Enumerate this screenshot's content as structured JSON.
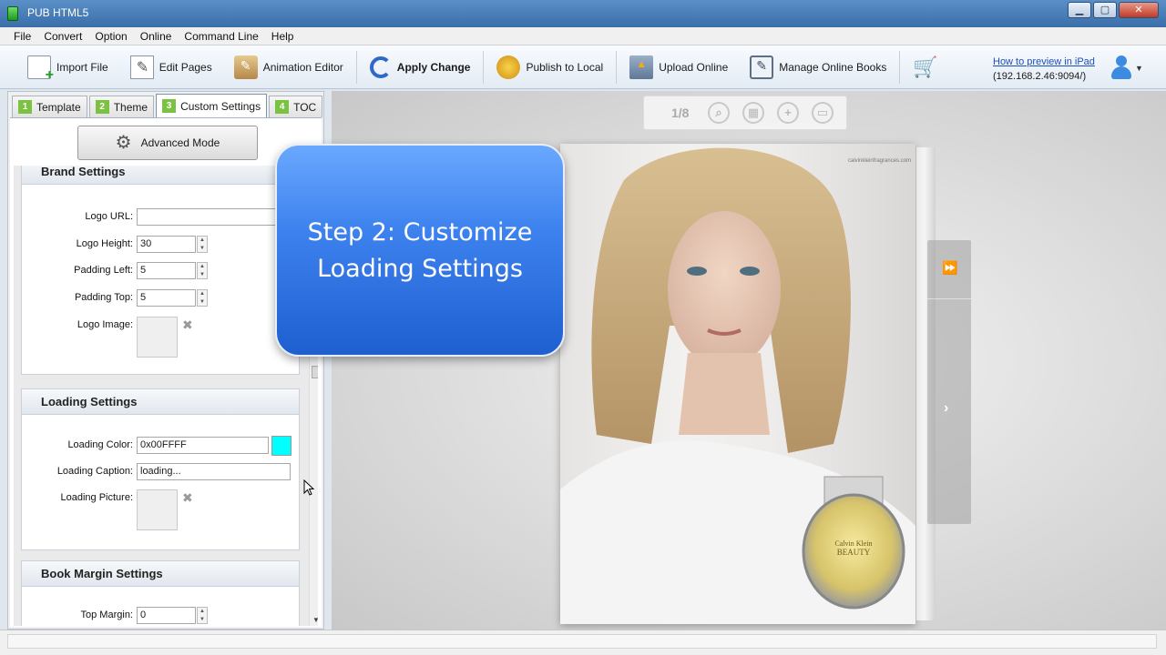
{
  "window": {
    "title": "PUB HTML5",
    "min": "▁",
    "max": "▢",
    "close": "✕"
  },
  "menu": [
    "File",
    "Convert",
    "Option",
    "Online",
    "Command Line",
    "Help"
  ],
  "toolbar": {
    "import": "Import File",
    "edit": "Edit Pages",
    "animation": "Animation Editor",
    "apply": "Apply Change",
    "publish": "Publish to Local",
    "upload": "Upload Online",
    "manage": "Manage Online Books",
    "preview_link": "How to preview in iPad",
    "ip": "(192.168.2.46:9094/)"
  },
  "tabs": [
    {
      "num": "1",
      "label": "Template"
    },
    {
      "num": "2",
      "label": "Theme"
    },
    {
      "num": "3",
      "label": "Custom Settings"
    },
    {
      "num": "4",
      "label": "TOC"
    }
  ],
  "advanced_mode": "Advanced Mode",
  "brand": {
    "title": "Brand Settings",
    "logo_url_label": "Logo URL:",
    "logo_url": "",
    "logo_height_label": "Logo Height:",
    "logo_height": "30",
    "padding_left_label": "Padding Left:",
    "padding_left": "5",
    "padding_top_label": "Padding Top:",
    "padding_top": "5",
    "logo_image_label": "Logo Image:"
  },
  "loading": {
    "title": "Loading Settings",
    "color_label": "Loading Color:",
    "color": "0x00FFFF",
    "swatch": "#00FFFF",
    "caption_label": "Loading Caption:",
    "caption": "loading...",
    "picture_label": "Loading Picture:"
  },
  "margin": {
    "title": "Book Margin Settings",
    "top_label": "Top Margin:",
    "top": "0"
  },
  "preview": {
    "page": "1/8",
    "url_mark": "calvinkleinfragrances.com",
    "brand_top": "Calvin Klein",
    "brand_bottom": "BEAUTY"
  },
  "callout": {
    "line1": "Step 2: Customize",
    "line2": "Loading Settings"
  },
  "colors": {
    "accent": "#1f5fd0",
    "tab_num": "#7bc142",
    "link": "#1a4fc2"
  }
}
